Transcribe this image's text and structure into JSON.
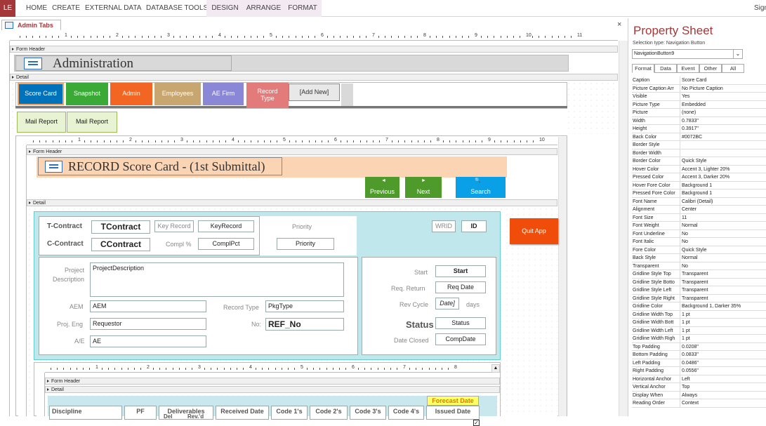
{
  "ribbon": {
    "file": "LE",
    "tabs": [
      "HOME",
      "CREATE",
      "EXTERNAL DATA",
      "DATABASE TOOLS",
      "DESIGN",
      "ARRANGE",
      "FORMAT"
    ],
    "signin": "Sign"
  },
  "doc": {
    "tab": "Admin Tabs",
    "close": "×"
  },
  "admin": {
    "form_header": "Form Header",
    "detail": "Detail",
    "title": "Administration",
    "tabs": [
      {
        "label": "Score Card",
        "color": "#0072BC"
      },
      {
        "label": "Snapshot",
        "color": "#3aa935"
      },
      {
        "label": "Admin",
        "color": "#f26522"
      },
      {
        "label": "Employees",
        "color": "#c7a670"
      },
      {
        "label": "AE Firm",
        "color": "#8a87d6"
      },
      {
        "label": "Record Type",
        "color": "#e47b7b"
      }
    ],
    "add_new": "[Add New]",
    "sub_tabs": [
      "Mail Report",
      "Mail Report"
    ]
  },
  "score": {
    "form_header": "Form Header",
    "detail": "Detail",
    "title": "RECORD Score Card - (1st Submittal)",
    "previous": "Previous",
    "next": "Next",
    "search": "Search",
    "search_icon_text": "🔍",
    "quit": "Quit App",
    "t_contract_lbl": "T-Contract",
    "t_contract": "TContract",
    "key_record_lbl": "Key Record",
    "key_record": "KeyRecord",
    "priority_lbl": "Priority",
    "priority": "Priority",
    "c_contract_lbl": "C-Contract",
    "c_contract": "CContract",
    "compl_lbl": "Compl %",
    "compl": "ComplPct",
    "wrid_lbl": "WRID",
    "wrid": "ID",
    "project_lbl": "Project Description",
    "project": "ProjectDescription",
    "aem_lbl": "AEM",
    "aem": "AEM",
    "record_type_lbl": "Record Type",
    "record_type": "PkgType",
    "proj_eng_lbl": "Proj. Eng",
    "proj_eng": "Requestor",
    "no_lbl": "No:",
    "no": "REF_No",
    "ae_lbl": "A/E",
    "ae": "AE",
    "start_lbl": "Start",
    "start": "Start",
    "req_return_lbl": "Req. Return",
    "req_return": "Req Date",
    "rev_cycle_lbl": "Rev Cycle",
    "rev_cycle": "Date]",
    "days": "days",
    "status_lbl": "Status",
    "status": "Status",
    "date_closed_lbl": "Date Closed",
    "date_closed": "CompDate"
  },
  "sub": {
    "form_header": "Form Header",
    "detail": "Detail",
    "forecast": "Forecast Date",
    "columns": [
      "Discipline",
      "PF",
      "Deliverables",
      "Received Date",
      "Code 1's",
      "Code 2's",
      "Code 3's",
      "Code 4's",
      "Issued Date"
    ],
    "del": "Del",
    "revd": "Rev.'d"
  },
  "rulers": {
    "main": [
      "1",
      "2",
      "3",
      "4",
      "5",
      "6",
      "7",
      "8",
      "9",
      "10",
      "11"
    ],
    "score": [
      "1",
      "2",
      "3",
      "4",
      "5",
      "6",
      "7",
      "8",
      "9",
      "10"
    ],
    "sub": [
      "1",
      "2",
      "3",
      "4",
      "5",
      "6",
      "7",
      "8"
    ]
  },
  "ps": {
    "title": "Property Sheet",
    "selection": "Selection type:  Navigation Button",
    "object": "NavigationButton9",
    "tabs": [
      "Format",
      "Data",
      "Event",
      "Other",
      "All"
    ],
    "rows": [
      [
        "Caption",
        "Score Card"
      ],
      [
        "Picture Caption Arr",
        "No Picture Caption"
      ],
      [
        "Visible",
        "Yes"
      ],
      [
        "Picture Type",
        "Embedded"
      ],
      [
        "Picture",
        "(none)"
      ],
      [
        "Width",
        "0.7833\""
      ],
      [
        "Height",
        "0.3917\""
      ],
      [
        "Back Color",
        "#0072BC"
      ],
      [
        "Border Style",
        ""
      ],
      [
        "Border Width",
        ""
      ],
      [
        "Border Color",
        "Quick Style"
      ],
      [
        "Hover Color",
        "Accent 3, Lighter 20%"
      ],
      [
        "Pressed Color",
        "Accent 3, Darker 20%"
      ],
      [
        "Hover Fore Color",
        "Background 1"
      ],
      [
        "Pressed Fore Color",
        "Background 1"
      ],
      [
        "Font Name",
        "Calibri (Detail)"
      ],
      [
        "Alignment",
        "Center"
      ],
      [
        "Font Size",
        "11"
      ],
      [
        "Font Weight",
        "Normal"
      ],
      [
        "Font Underline",
        "No"
      ],
      [
        "Font Italic",
        "No"
      ],
      [
        "Fore Color",
        "Quick Style"
      ],
      [
        "Back Style",
        "Normal"
      ],
      [
        "Transparent",
        "No"
      ],
      [
        "Gridline Style Top",
        "Transparent"
      ],
      [
        "Gridline Style Botto",
        "Transparent"
      ],
      [
        "Gridline Style Left",
        "Transparent"
      ],
      [
        "Gridline Style Right",
        "Transparent"
      ],
      [
        "Gridline Color",
        "Background 1, Darker 35%"
      ],
      [
        "Gridline Width Top",
        "1 pt"
      ],
      [
        "Gridline Width Bott",
        "1 pt"
      ],
      [
        "Gridline Width Left",
        "1 pt"
      ],
      [
        "Gridline Width Righ",
        "1 pt"
      ],
      [
        "Top Padding",
        "0.0208\""
      ],
      [
        "Bottom Padding",
        "0.0833\""
      ],
      [
        "Left Padding",
        "0.0486\""
      ],
      [
        "Right Padding",
        "0.0556\""
      ],
      [
        "Horizontal Anchor",
        "Left"
      ],
      [
        "Vertical Anchor",
        "Top"
      ],
      [
        "Display When",
        "Always"
      ],
      [
        "Reading Order",
        "Context"
      ]
    ]
  }
}
